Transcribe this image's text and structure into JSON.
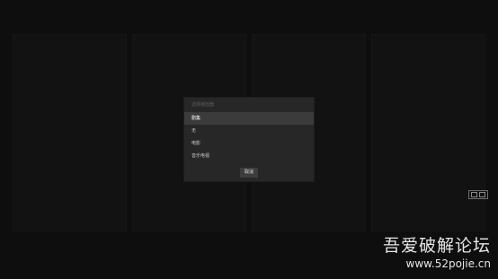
{
  "dialog": {
    "title": "选择播放器",
    "items": [
      "剧集",
      "无",
      "电影",
      "音乐电视"
    ],
    "selected_index": 0,
    "cancel_label": "取消"
  },
  "watermark": {
    "title": "吾爱破解论坛",
    "url": "www.52pojie.cn"
  },
  "colors": {
    "background": "#121212",
    "dialog": "#272727",
    "selected": "#3b3b3b"
  }
}
